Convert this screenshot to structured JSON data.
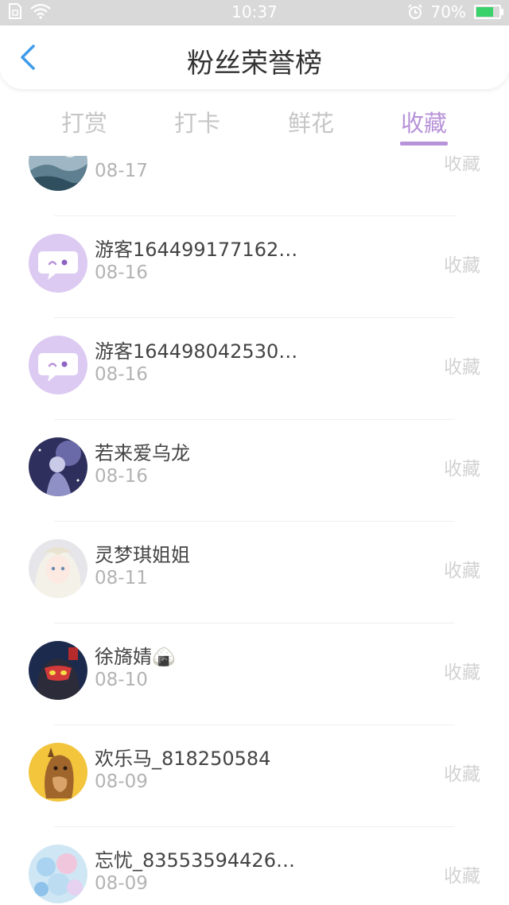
{
  "status_bar": {
    "time": "10:37",
    "battery": "70%",
    "battery_level": 0.7
  },
  "header": {
    "title": "粉丝荣誉榜"
  },
  "tabs": [
    {
      "label": "打赏"
    },
    {
      "label": "打卡"
    },
    {
      "label": "鲜花"
    },
    {
      "label": "收藏",
      "active": true
    }
  ],
  "rows": [
    {
      "name": "",
      "date": "08-17",
      "action": "收藏",
      "avatar": "winter-scene"
    },
    {
      "name": "游客164499177162…",
      "date": "08-16",
      "action": "收藏",
      "avatar": "default-chat"
    },
    {
      "name": "游客164498042530…",
      "date": "08-16",
      "action": "收藏",
      "avatar": "default-chat"
    },
    {
      "name": "若来爱乌龙",
      "date": "08-16",
      "action": "收藏",
      "avatar": "night-girl"
    },
    {
      "name": "灵梦琪姐姐",
      "date": "08-11",
      "action": "收藏",
      "avatar": "anime-girl"
    },
    {
      "name": "徐旖婧🍙",
      "date": "08-10",
      "action": "收藏",
      "avatar": "red-mask"
    },
    {
      "name": "欢乐马_818250584",
      "date": "08-09",
      "action": "收藏",
      "avatar": "horse"
    },
    {
      "name": "忘忧_83553594426…",
      "date": "08-09",
      "action": "收藏",
      "avatar": "flowers"
    }
  ],
  "colors": {
    "accent": "#b893d9",
    "avatar_default": "#dccaf2"
  }
}
